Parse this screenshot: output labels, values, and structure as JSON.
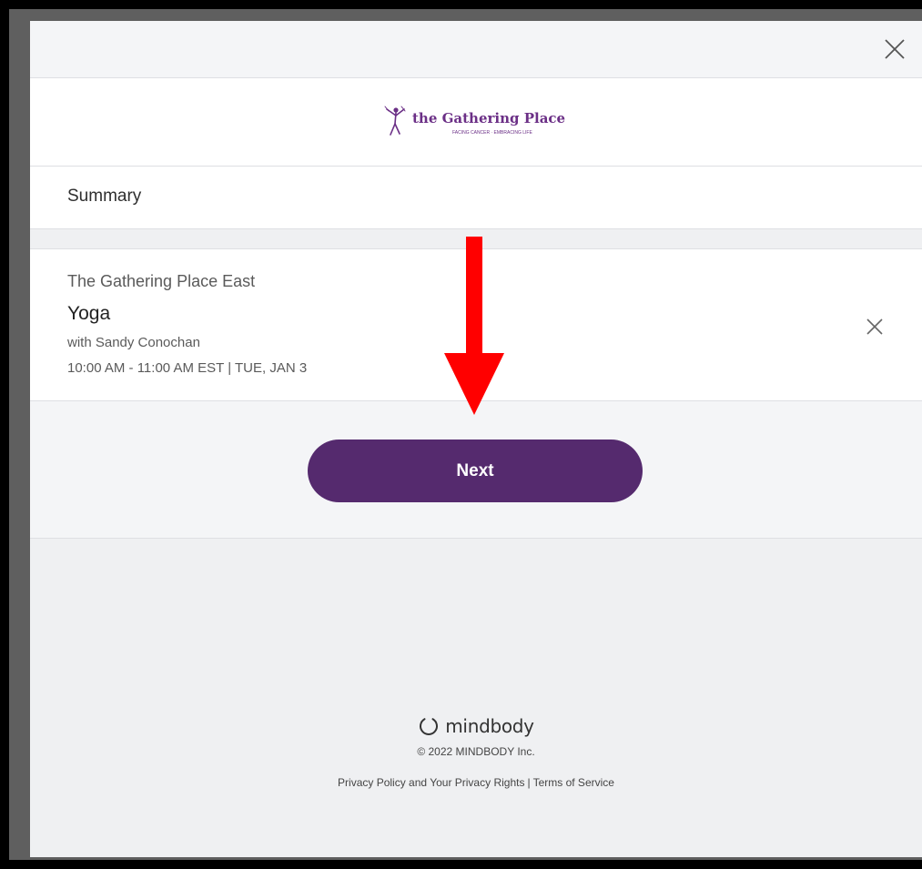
{
  "modal": {
    "close_icon": "close-icon"
  },
  "logo": {
    "primary_text": "the Gathering Place",
    "tagline": "FACING CANCER · EMBRACING LIFE",
    "icon": "dancing-figure-icon"
  },
  "summary": {
    "title": "Summary"
  },
  "item": {
    "location": "The Gathering Place East",
    "name": "Yoga",
    "instructor": "with Sandy Conochan",
    "time": "10:00 AM - 11:00 AM EST | TUE, JAN 3",
    "remove_icon": "close-icon"
  },
  "actions": {
    "next_label": "Next"
  },
  "footer": {
    "brand": "mindbody",
    "brand_icon": "mindbody-circle-icon",
    "copyright": "© 2022 MINDBODY Inc.",
    "privacy_link": "Privacy Policy and Your Privacy Rights",
    "separator": "|",
    "terms_link": "Terms of Service"
  },
  "annotation": {
    "arrow_icon": "red-down-arrow-icon"
  },
  "colors": {
    "accent": "#552a6e",
    "logo_purple": "#6b2f86",
    "annotation_red": "#ff0000",
    "page_background": "#eff0f2"
  }
}
